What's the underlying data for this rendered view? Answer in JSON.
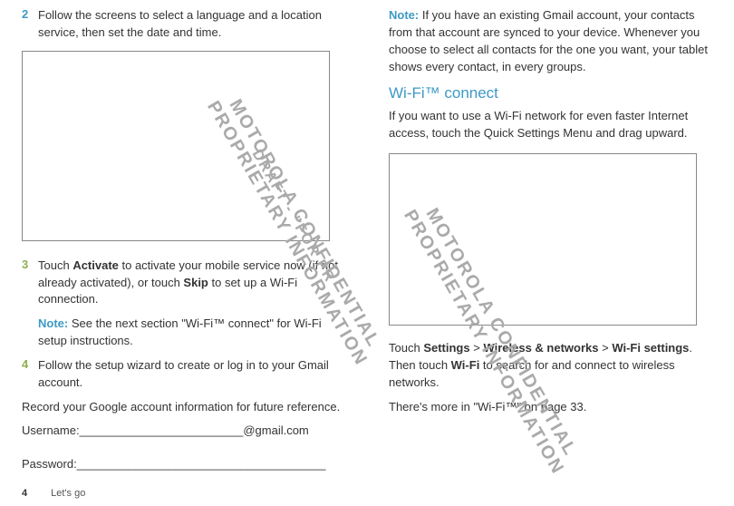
{
  "left": {
    "step2": {
      "num": "2",
      "text": "Follow the screens to select a language and a location service, then set the date and time."
    },
    "step3": {
      "num": "3",
      "text_a": "Touch ",
      "bold_a": "Activate",
      "text_b": " to activate your mobile service now (if not already activated), or touch ",
      "bold_b": "Skip",
      "text_c": " to set up a Wi-Fi connection."
    },
    "note": {
      "label": "Note: ",
      "text": "See the next section \"Wi-Fi™ connect\" for Wi-Fi setup instructions."
    },
    "step4": {
      "num": "4",
      "text": "Follow the setup wizard to create or log in to your Gmail account."
    },
    "record": "Record your Google account information for future reference.",
    "username_label": "Username:",
    "username_suffix": "@gmail.com",
    "password_label": "Password:"
  },
  "right": {
    "note_top": {
      "label": "Note: ",
      "text": "If you have an existing Gmail account, your contacts from that account are synced to your device. Whenever you choose to select all contacts for the one you want, your tablet shows every contact, in every groups."
    },
    "heading": "Wi-Fi™ connect",
    "wifi_intro": "If you want to use a Wi-Fi network for even faster Internet access, touch the Quick Settings Menu and drag upward.",
    "settings": {
      "a": "Touch ",
      "b": "Settings",
      "c": " > ",
      "d": "Wireless & networks",
      "e": " > ",
      "f": "Wi-Fi settings",
      "g": ". Then touch ",
      "h": "Wi-Fi",
      "i": " to search for and connect to wireless networks."
    },
    "more": "There's more in \"Wi-Fi™\" on page 33."
  },
  "footer": {
    "page": "4",
    "section": "Let's go"
  },
  "watermarks": {
    "w1": "MOTOROLA CONFIDENTIAL\nPROPRIETARY INFORMATION",
    "w2": "DRAFT - \"FOR PR",
    "w3": "MOTOROLA CONFIDENTIAL\nPROPRIETARY INFORMATION"
  }
}
